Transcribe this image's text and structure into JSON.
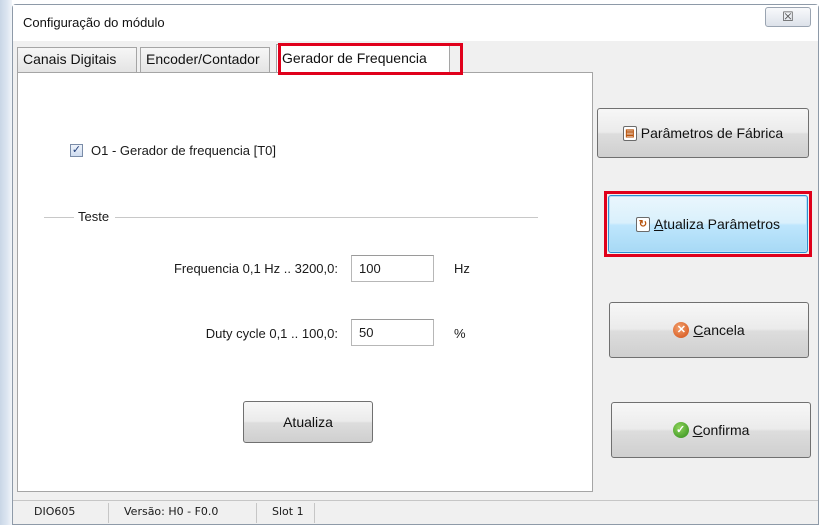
{
  "window": {
    "title": "Configuração do módulo",
    "close_glyph": "☒"
  },
  "tabs": [
    {
      "label": "Canais Digitais"
    },
    {
      "label": "Encoder/Contador"
    },
    {
      "label": "Gerador de Frequencia"
    }
  ],
  "active_tab": "Gerador de Frequencia",
  "panel": {
    "checkbox_label": "O1 - Gerador de frequencia [T0]",
    "checkbox_checked": true,
    "group_label": "Teste",
    "frequency_label": "Frequencia 0,1 Hz .. 3200,0:",
    "frequency_value": "100",
    "frequency_unit": "Hz",
    "duty_label": "Duty cycle 0,1 .. 100,0:",
    "duty_value": "50",
    "duty_unit": "%",
    "update_button": "Atualiza"
  },
  "buttons": {
    "factory_label": "Parâmetros de Fábrica",
    "update_params_first": "A",
    "update_params_rest": "tualiza Parâmetros",
    "cancel_first": "C",
    "cancel_rest": "ancela",
    "confirm_first": "C",
    "confirm_rest": "onfirma"
  },
  "statusbar": {
    "device": "DIO605",
    "version": "Versão: H0 - F0.0",
    "slot": "Slot 1"
  },
  "colors": {
    "highlight": "#e0001b",
    "focus_border": "#2d8fd0"
  },
  "icons": {
    "factory": "document-icon",
    "update": "refresh-document-icon",
    "cancel": "cancel-icon",
    "confirm": "check-icon"
  }
}
